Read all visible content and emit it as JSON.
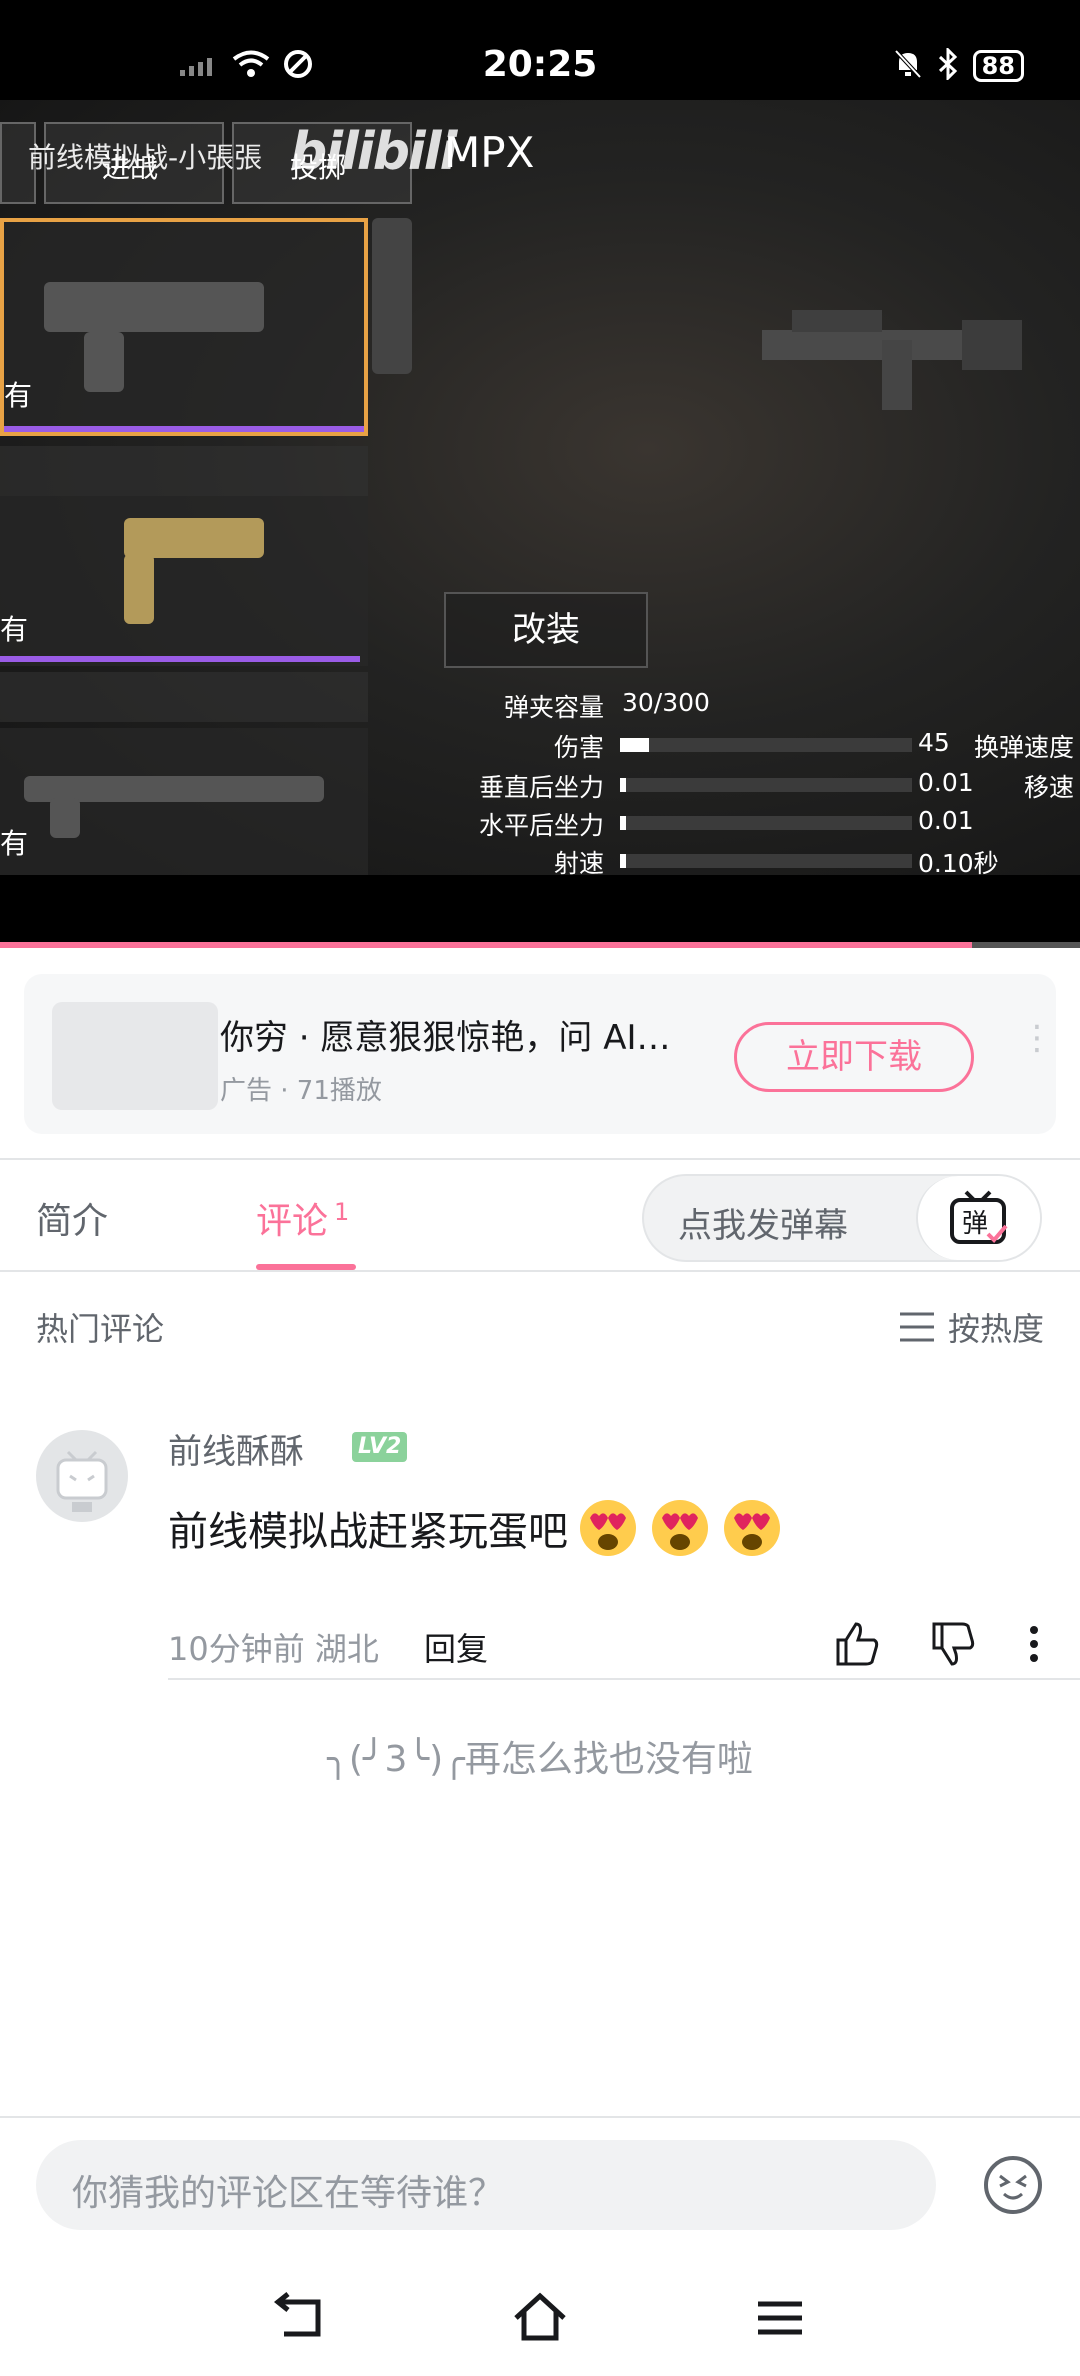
{
  "status_bar": {
    "time": "20:25",
    "battery": "88"
  },
  "video": {
    "overlay_title": "前线模拟战-小張張",
    "logo_text": "bilibili",
    "tab_left": "进战",
    "tab_mid": "投掷",
    "weapon_name": "MPX",
    "slot_label_1": "有",
    "slot_label_2": "有",
    "slot_label_3": "有",
    "mod_button": "改装",
    "stats": [
      {
        "name": "弹夹容量",
        "value": "30/300",
        "extra": ""
      },
      {
        "name": "伤害",
        "value": "45",
        "extra": "换弹速度",
        "fill": 0.1
      },
      {
        "name": "垂直后坐力",
        "value": "0.01",
        "extra": "移速",
        "fill": 0.02
      },
      {
        "name": "水平后坐力",
        "value": "0.01",
        "extra": "",
        "fill": 0.02
      },
      {
        "name": "射速",
        "value": "0.10秒",
        "extra": "",
        "fill": 0.02
      }
    ],
    "progress": 0.9
  },
  "ad": {
    "title": "你穷 · 愿意狠狠惊艳，问 AI…",
    "subtitle": "广告 · 71播放",
    "download_label": "立即下载"
  },
  "tabs": {
    "intro": "简介",
    "comments": "评论",
    "comments_count": "1",
    "danmaku_placeholder": "点我发弹幕",
    "danmaku_button": "弹"
  },
  "comments_section": {
    "header": "热门评论",
    "sort_label": "按热度"
  },
  "comment": {
    "username": "前线酥酥",
    "level": "LV2",
    "text": "前线模拟战赶紧玩蛋吧",
    "time": "10分钟前",
    "location": "湖北",
    "reply_label": "回复"
  },
  "end_text": "╮(╯3╰)╭再怎么找也没有啦",
  "bottom": {
    "input_placeholder": "你猜我的评论区在等待谁？"
  },
  "colors": {
    "accent": "#fb7299",
    "level": "#8bd29b"
  }
}
